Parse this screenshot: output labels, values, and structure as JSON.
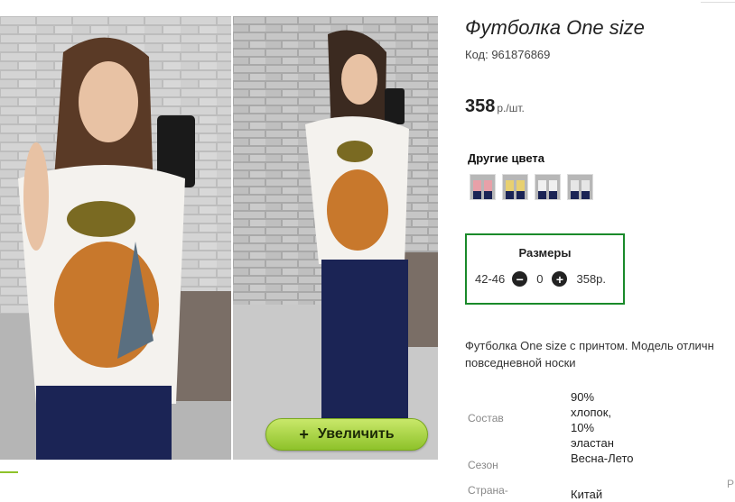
{
  "product": {
    "title": "Футболка One size",
    "code": "Код: 961876869",
    "price": "358",
    "price_unit": "р./шт."
  },
  "other_colors": {
    "label": "Другие цвета",
    "swatches": [
      {
        "name": "pink",
        "color": "#e8a0a8"
      },
      {
        "name": "yellow",
        "color": "#e8d070"
      },
      {
        "name": "white",
        "color": "#f0f0f0"
      },
      {
        "name": "white-2",
        "color": "#e6e6e6"
      }
    ]
  },
  "sizes": {
    "title": "Размеры",
    "range": "42-46",
    "quantity": "0",
    "price": "358р.",
    "minus_icon": "minus-circle-icon",
    "plus_icon": "plus-circle-icon"
  },
  "zoom_button": {
    "icon": "+",
    "label": "Увеличить"
  },
  "description": {
    "line1": "Футболка One size с принтом. Модель отличн",
    "line2": "повседневной носки"
  },
  "specs": [
    {
      "key": "Состав",
      "value": "90% хлопок, 10% эластан"
    },
    {
      "key": "Сезон",
      "value": "Весна-Лето"
    },
    {
      "key": "Страна-",
      "value": "Китай"
    }
  ],
  "edge_letter": "Р",
  "colors": {
    "accent_green": "#8ec22a",
    "sizes_border": "#1a8a2a"
  }
}
